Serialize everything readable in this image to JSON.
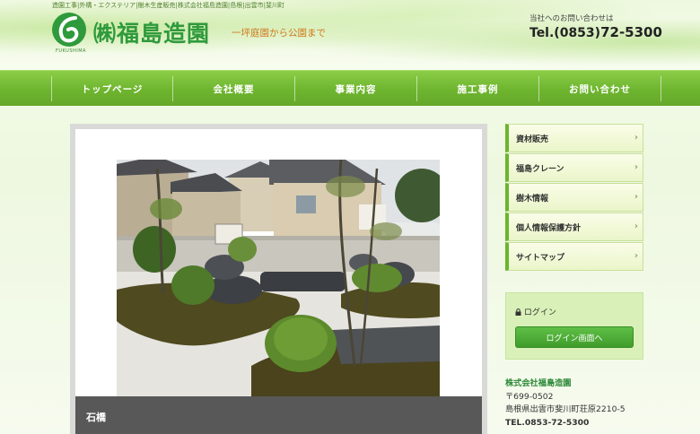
{
  "header": {
    "topline": "造園工事|外構・エクステリア|樹木生産販売|株式会社福島造園|島根|出雲市|斐川町",
    "logo_text": "㈱福島造園",
    "logo_sub": "FUKUSHIMA",
    "tagline": "一坪庭園から公園まで",
    "contact_label": "当社へのお問い合わせは",
    "tel_prefix": "Tel.(0853)",
    "tel_number": "72-5300"
  },
  "nav": {
    "items": [
      {
        "label": "トップページ"
      },
      {
        "label": "会社概要"
      },
      {
        "label": "事業内容"
      },
      {
        "label": "施工事例"
      },
      {
        "label": "お問い合わせ"
      }
    ]
  },
  "main": {
    "caption": "石橋"
  },
  "sidebar": {
    "items": [
      {
        "label": "資材販売"
      },
      {
        "label": "福島クレーン"
      },
      {
        "label": "樹木情報"
      },
      {
        "label": "個人情報保護方針"
      },
      {
        "label": "サイトマップ"
      }
    ],
    "login_title": "ログイン",
    "login_button": "ログイン画面へ"
  },
  "company": {
    "name": "株式会社福島造園",
    "postal": "〒699-0502",
    "address": "島根県出雲市斐川町荘原2210-5",
    "tel": "TEL.0853-72-5300"
  },
  "colors": {
    "nav_green": "#6eb52f",
    "logo_green": "#2f9a3c",
    "tagline_orange": "#d07a1c",
    "login_button": "#3f9c2b"
  }
}
